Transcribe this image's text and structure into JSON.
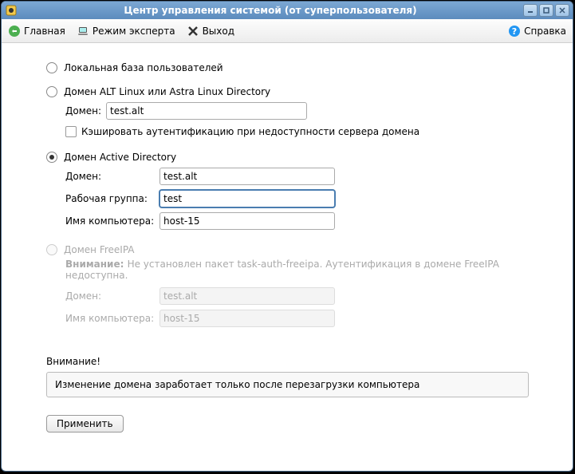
{
  "window": {
    "title": "Центр управления системой (от суперпользователя)"
  },
  "toolbar": {
    "home": "Главная",
    "expert": "Режим эксперта",
    "exit": "Выход",
    "help": "Справка"
  },
  "sections": {
    "local": {
      "label": "Локальная база пользователей"
    },
    "alt": {
      "label": "Домен ALT Linux или Astra Linux Directory",
      "domain_label": "Домен:",
      "domain_value": "test.alt",
      "cache_label": "Кэшировать аутентификацию при недоступности сервера домена"
    },
    "ad": {
      "label": "Домен Active Directory",
      "domain_label": "Домен:",
      "domain_value": "test.alt",
      "workgroup_label": "Рабочая группа:",
      "workgroup_value": "test",
      "hostname_label": "Имя компьютера:",
      "hostname_value": "host-15"
    },
    "freeipa": {
      "label": "Домен FreeIPA",
      "warning_prefix": "Внимание: ",
      "warning_text": "Не установлен пакет task-auth-freeipa. Аутентификация в домене FreeIPA недоступна.",
      "domain_label": "Домен:",
      "domain_value": "test.alt",
      "hostname_label": "Имя компьютера:",
      "hostname_value": "host-15"
    }
  },
  "attention": {
    "title": "Внимание!",
    "message": "Изменение домена заработает только после перезагрузки компьютера"
  },
  "apply_label": "Применить"
}
